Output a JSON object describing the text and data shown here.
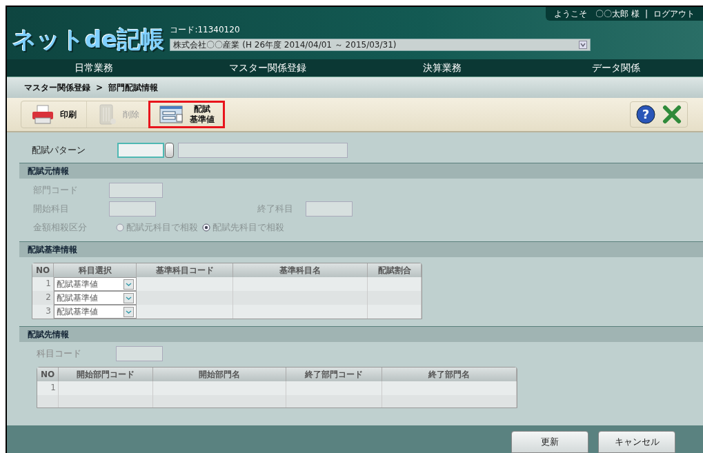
{
  "header": {
    "logo": "ネットde記帳",
    "code": "コード:11340120",
    "company": "株式会社〇〇産業 (H 26年度 2014/04/01 ～ 2015/03/31)",
    "welcome": "ようこそ　〇〇太郎 様",
    "separator": "|",
    "logout": "ログアウト"
  },
  "help": "?",
  "nav": [
    "日常業務",
    "マスター関係登録",
    "決算業務",
    "データ関係"
  ],
  "breadcrumb": {
    "parent": "マスター関係登録",
    "separator": ">",
    "current": "部門配賦情報"
  },
  "toolbar": [
    {
      "kind": "print",
      "lines": [
        "印刷"
      ],
      "disabled": false,
      "highlighted": false
    },
    {
      "kind": "delete",
      "lines": [
        "削除"
      ],
      "disabled": true,
      "highlighted": false
    },
    {
      "kind": "standard",
      "lines": [
        "配賦",
        "基準値"
      ],
      "disabled": false,
      "highlighted": true
    }
  ],
  "pattern": {
    "label": "配賦パターン"
  },
  "source": {
    "title": "配賦元情報",
    "dept_label": "部門コード",
    "start_label": "開始科目",
    "end_label": "終了科目",
    "offset_label": "金額相殺区分",
    "disabled": true,
    "options": [
      {
        "label": "配賦元科目で相殺",
        "selected": false
      },
      {
        "label": "配賦先科目で相殺",
        "selected": true
      }
    ]
  },
  "basis": {
    "title": "配賦基準情報",
    "columns": [
      "NO",
      "科目選択",
      "基準科目コード",
      "基準科目名",
      "配賦割合"
    ],
    "rows": [
      {
        "no": "1",
        "select": "配賦基準値"
      },
      {
        "no": "2",
        "select": "配賦基準値"
      },
      {
        "no": "3",
        "select": "配賦基準値"
      }
    ]
  },
  "target": {
    "title": "配賦先情報",
    "code_label": "科目コード",
    "disabled": true,
    "columns": [
      "NO",
      "開始部門コード",
      "開始部門名",
      "終了部門コード",
      "終了部門名"
    ],
    "rows": [
      {
        "no": "1"
      }
    ]
  },
  "footer": [
    "更新",
    "キャンセル"
  ]
}
